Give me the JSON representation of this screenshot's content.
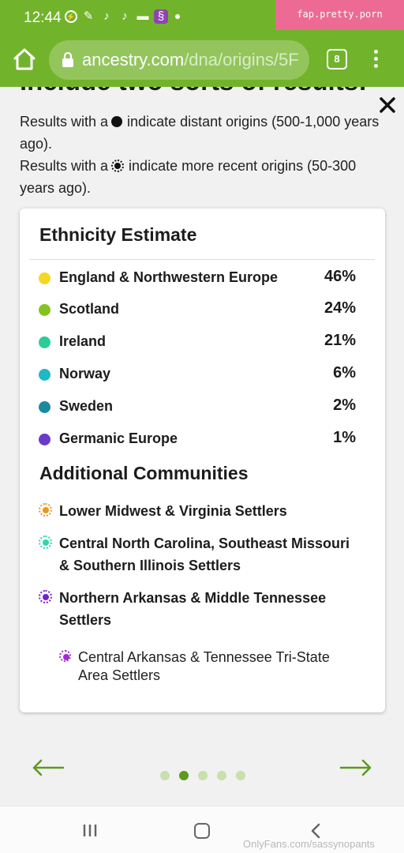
{
  "status_bar": {
    "time": "12:44",
    "icons": [
      "messenger-icon",
      "chat-icon",
      "tiktok-icon",
      "tiktok-icon",
      "message-icon",
      "app-icon",
      "dot-icon"
    ]
  },
  "watermark_top": "fap.pretty.porn",
  "browser": {
    "url_host": "ancestry.com",
    "url_path": "/dna/origins/5F",
    "tab_count": "8"
  },
  "page": {
    "cut_heading": "include two sorts of results:",
    "intro_distant_prefix": "Results with a",
    "intro_distant_suffix": "indicate distant origins (500-1,000 years ago).",
    "intro_recent_prefix": "Results with a",
    "intro_recent_suffix": "indicate more recent origins (50-300 years ago)."
  },
  "card": {
    "title": "Ethnicity Estimate",
    "ethnicities": [
      {
        "name": "England & Northwestern Europe",
        "percent": "46%",
        "color": "#f2d822"
      },
      {
        "name": "Scotland",
        "percent": "24%",
        "color": "#86c21f"
      },
      {
        "name": "Ireland",
        "percent": "21%",
        "color": "#2ccc99"
      },
      {
        "name": "Norway",
        "percent": "6%",
        "color": "#1fb8c6"
      },
      {
        "name": "Sweden",
        "percent": "2%",
        "color": "#1a8aa0"
      },
      {
        "name": "Germanic Europe",
        "percent": "1%",
        "color": "#6a3bc8"
      }
    ],
    "communities_title": "Additional Communities",
    "communities": [
      {
        "name": "Lower Midwest & Virginia Settlers",
        "color": "#f0941f"
      },
      {
        "name": "Central North Carolina, Southeast Missouri & Southern Illinois Settlers",
        "color": "#2fd6b0"
      },
      {
        "name": "Northern Arkansas & Middle Tennessee Settlers",
        "color": "#7a1fc8"
      }
    ],
    "sub_community": {
      "name": "Central Arkansas & Tennessee Tri-State Area Settlers",
      "color": "#a32bd1"
    }
  },
  "pager": {
    "count": 5,
    "active": 2
  },
  "watermark_bottom": "OnlyFans.com/sassynopants",
  "colors": {
    "brand_green": "#72b32c",
    "arrow_green": "#5d9a1e"
  }
}
